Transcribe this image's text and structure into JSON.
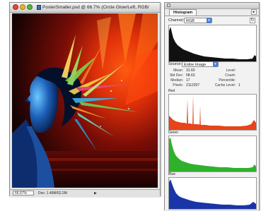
{
  "document": {
    "title": "PosterSmaller.psd @ 66.7% (Circle Glow/Left, RGB/",
    "zoom": "66.67%",
    "doc_info": "Doc: 1.49M/52.2M"
  },
  "histogram": {
    "tab_label": "Histogram",
    "channel_label": "Channel:",
    "channel_value": "RGB",
    "source_label": "Source:",
    "source_value": "Entire Image",
    "stats_left": [
      {
        "label": "Mean:",
        "value": "31.60"
      },
      {
        "label": "Std Dev:",
        "value": "58.63"
      },
      {
        "label": "Median:",
        "value": "17"
      },
      {
        "label": "Pixels:",
        "value": "2112207"
      }
    ],
    "stats_right": [
      {
        "label": "Level:",
        "value": ""
      },
      {
        "label": "Count:",
        "value": ""
      },
      {
        "label": "Percentile:",
        "value": ""
      },
      {
        "label": "Cache Level:",
        "value": "1"
      }
    ],
    "channels": [
      {
        "label": "Red",
        "color": "#e8431a"
      },
      {
        "label": "Green",
        "color": "#2fb12c"
      },
      {
        "label": "Blue",
        "color": "#1a35a8"
      }
    ],
    "main_color": "#111111"
  },
  "icons": {
    "close": "close-icon",
    "menu": "palette-menu-icon",
    "refresh": "refresh-icon",
    "dropdown": "chevron-down-icon"
  }
}
